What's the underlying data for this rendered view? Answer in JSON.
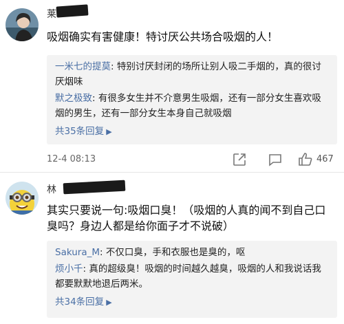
{
  "comments": [
    {
      "username": "莱",
      "text": "吸烟确实有害健康！特讨厌公共场合吸烟的人！",
      "replies": [
        {
          "name": "一米七的提莫",
          "text": "特别讨厌封闭的场所让别人吸二手烟的，真的很讨厌烟味"
        },
        {
          "name": "默之极致",
          "text": "有很多女生并不介意男生吸烟，还有一部分女生喜欢吸烟的男生，还有一部分女生本身自己就吸烟"
        }
      ],
      "more_replies": "共35条回复",
      "time": "12-4 08:13",
      "likes": "467"
    },
    {
      "username": "林",
      "text": "其实只要说一句:吸烟口臭！（吸烟的人真的闻不到自己口臭吗？身边人都是给你面子才不说破）",
      "replies": [
        {
          "name": "Sakura_M",
          "text": "不仅口臭，手和衣服也是臭的，呕"
        },
        {
          "name": "烦小千",
          "text": "真的超级臭！吸烟的时间越久越臭，吸烟的人和我说话我都要默默地退后两米。"
        }
      ],
      "more_replies": "共34条回复"
    }
  ],
  "colors": {
    "link": "#4a6fa5",
    "reply_bg": "#f3f3f3"
  },
  "icons": [
    "share-icon",
    "comment-icon",
    "thumbs-up-icon",
    "chevron-right-icon"
  ]
}
